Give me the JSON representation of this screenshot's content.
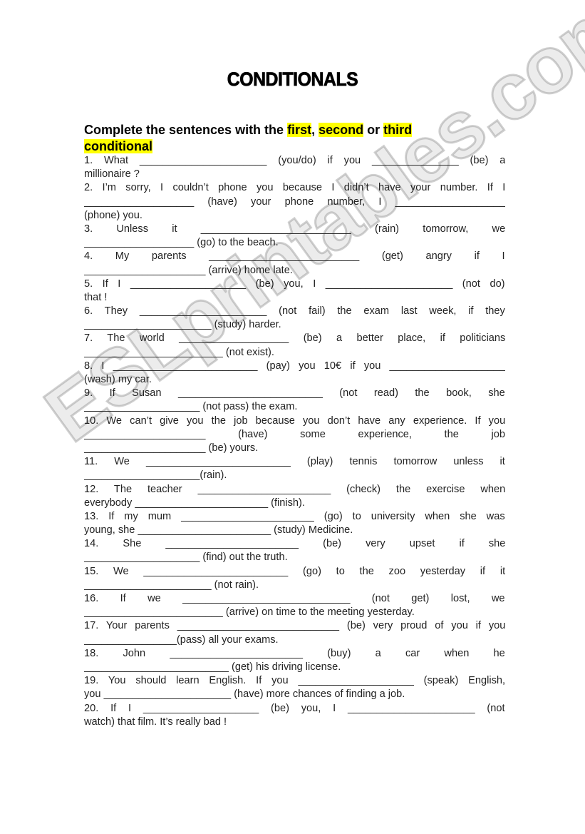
{
  "document": {
    "title": "CONDITIONALS",
    "instruction": {
      "prefix": "Complete the sentences with the ",
      "first": "first",
      "comma": ", ",
      "second": "second",
      "or": " or ",
      "third": "third",
      "conditional": "conditional",
      "highlight_color": "#ffff00"
    },
    "watermark": "ESLprintables.com",
    "lines": [
      "1. What ______________________ (you/do) if you _______________ (be) a",
      "millionaire ?",
      "2. I’m sorry, I couldn’t phone you because I didn’t have your number. If I",
      "___________________ (have) your phone number, I ___________________",
      "(phone) you.",
      "3. Unless it __________________________ (rain) tomorrow, we",
      "___________________ (go) to the beach.",
      "4. My parents __________________________ (get) angry if I",
      "_____________________ (arrive) home late.",
      "5. If I ____________________ (be) you, I ______________________ (not do)",
      "that !",
      "6. They ______________________ (not fail) the exam last week, if they",
      "______________________ (study) harder.",
      "7. The world ___________________ (be) a better place, if politicians",
      "________________________ (not exist).",
      "8. I _________________________ (pay) you 10€ if you ____________________",
      "(wash) my car.",
      "9. If Susan _________________________ (not read) the book, she",
      "____________________ (not pass) the exam.",
      "10. We can’t give you the job because you don’t have any experience. If you",
      "_____________________ (have) some experience, the job",
      "_____________________ (be) yours.",
      "11. We _________________________ (play) tennis tomorrow unless it",
      "____________________(rain).",
      "12. The teacher _______________________ (check) the exercise when",
      "everybody _______________________ (finish).",
      "13. If my mum _______________________ (go) to university when she was",
      "young, she _______________________ (study) Medicine.",
      "14. She _______________________ (be) very upset if she",
      "____________________ (find) out the truth.",
      "15. We _________________________ (go) to the zoo yesterday if it",
      "______________________ (not rain).",
      "16. If we _____________________________ (not get) lost, we",
      "________________________ (arrive) on time to the meeting yesterday.",
      "17. Your parents ____________________________ (be) very proud of you if you",
      "________________(pass) all your exams.",
      "18. John _______________________ (buy) a car when he",
      "_________________________ (get) his driving license.",
      "19. You should learn English. If you ____________________ (speak) English,",
      "you ______________________ (have) more chances of finding a job.",
      "20. If I ____________________ (be) you, I ______________________ (not",
      "watch) that film. It’s really bad !"
    ],
    "last_lines": [
      1,
      4,
      6,
      8,
      10,
      12,
      14,
      16,
      18,
      21,
      23,
      25,
      27,
      29,
      31,
      33,
      35,
      37,
      39,
      41
    ]
  }
}
